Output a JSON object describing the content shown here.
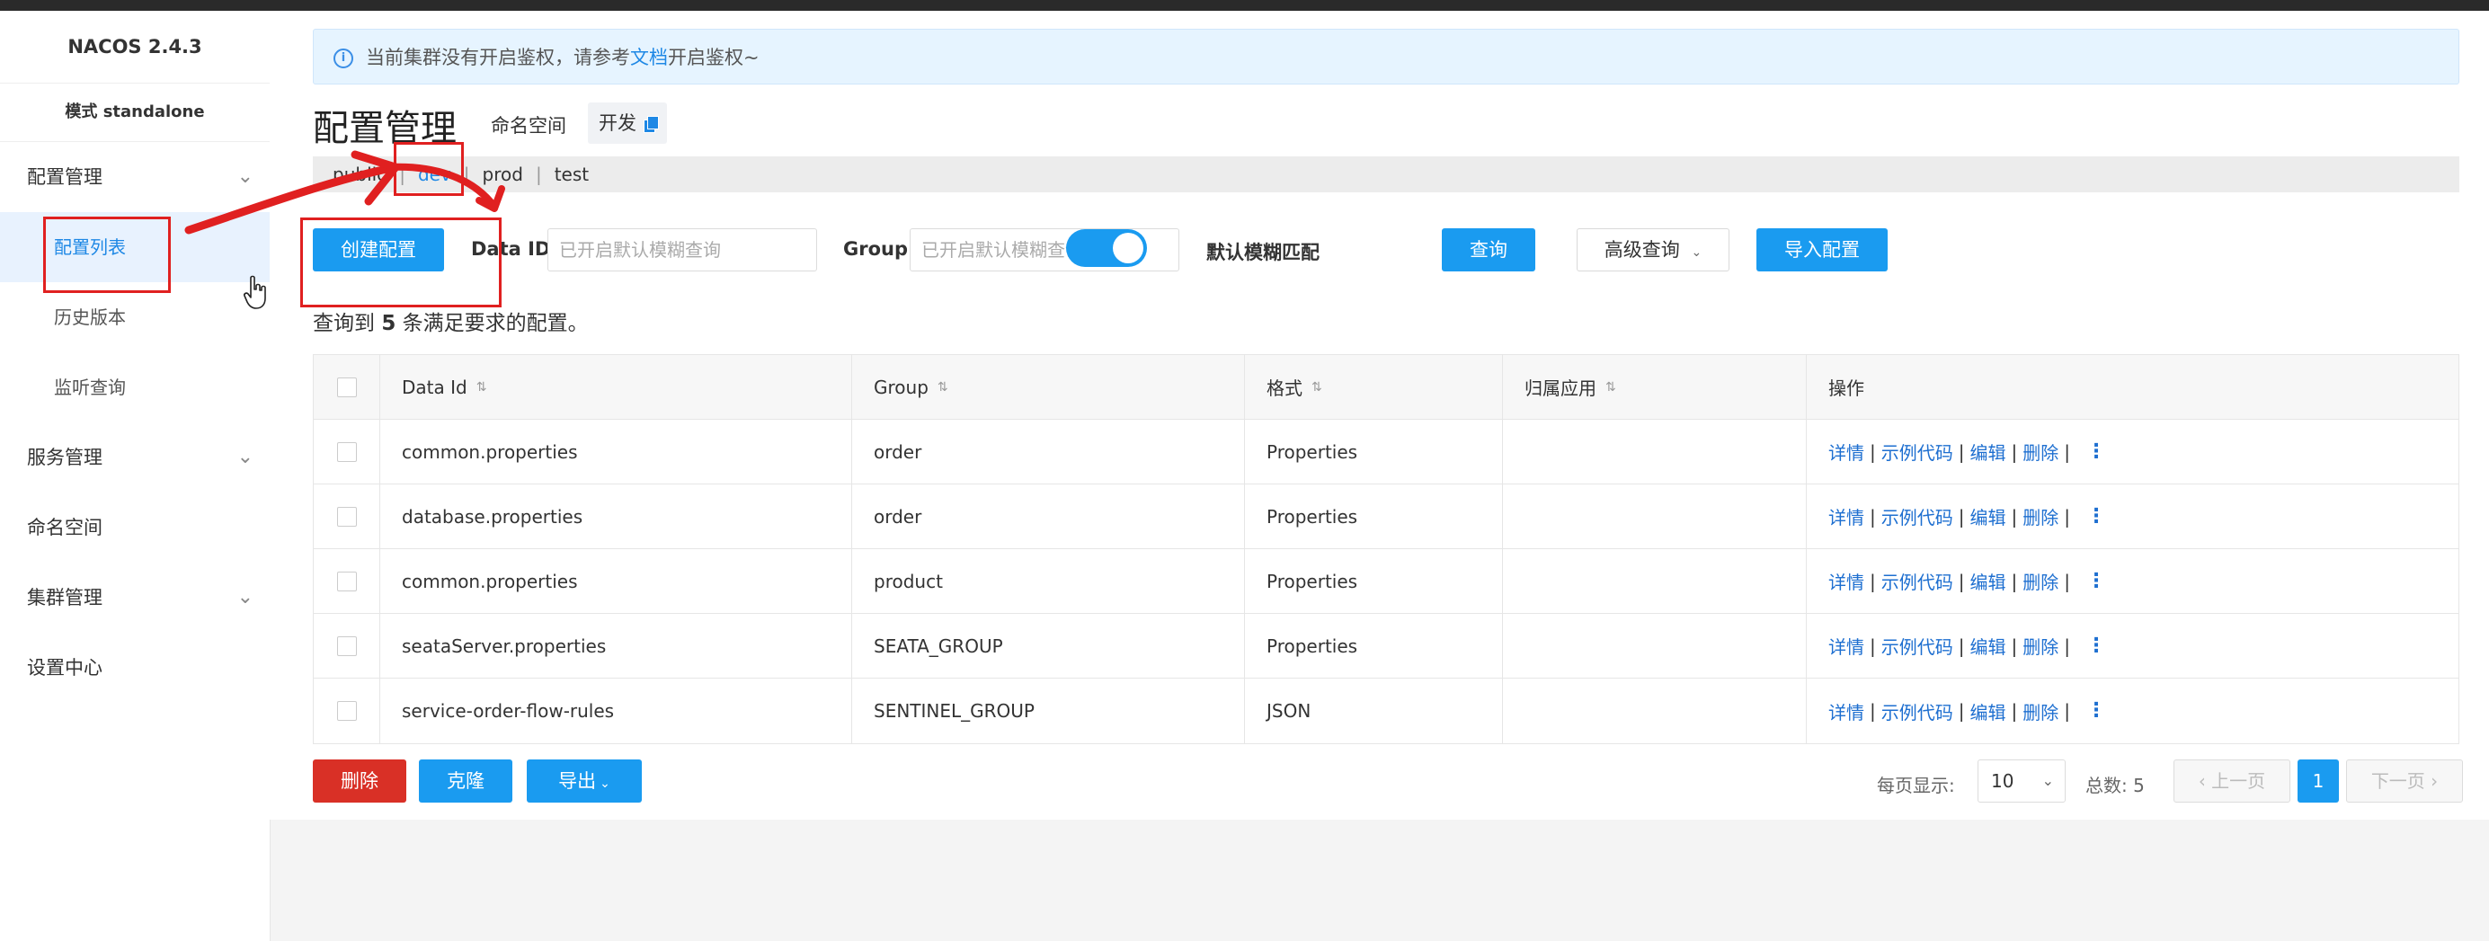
{
  "app": {
    "brand": "NACOS 2.4.3",
    "mode": "模式 standalone"
  },
  "sidebar": {
    "items": [
      {
        "label": "配置管理",
        "expandable": true
      },
      {
        "label": "配置列表",
        "active": true
      },
      {
        "label": "历史版本"
      },
      {
        "label": "监听查询"
      },
      {
        "label": "服务管理",
        "expandable": true
      },
      {
        "label": "命名空间"
      },
      {
        "label": "集群管理",
        "expandable": true
      },
      {
        "label": "设置中心"
      }
    ]
  },
  "notice": {
    "before": "当前集群没有开启鉴权，请参考",
    "link": "文档",
    "after": "开启鉴权~"
  },
  "header": {
    "title": "配置管理",
    "namespace_label": "命名空间",
    "namespace_current": "开发"
  },
  "namespace_tabs": [
    {
      "label": "public",
      "active": false
    },
    {
      "label": "dev",
      "active": true
    },
    {
      "label": "prod",
      "active": false
    },
    {
      "label": "test",
      "active": false
    }
  ],
  "toolbar": {
    "create_button": "创建配置",
    "data_id_label": "Data ID",
    "data_id_placeholder": "已开启默认模糊查询",
    "group_label": "Group",
    "group_placeholder": "已开启默认模糊查询",
    "fuzzy_label": "默认模糊匹配",
    "fuzzy_enabled": true,
    "query_button": "查询",
    "advanced_button": "高级查询",
    "import_button": "导入配置"
  },
  "result": {
    "prefix": "查询到",
    "count": "5",
    "suffix": "条满足要求的配置。"
  },
  "table": {
    "columns": [
      "Data Id",
      "Group",
      "格式",
      "归属应用",
      "操作"
    ],
    "rows": [
      {
        "data_id": "common.properties",
        "group": "order",
        "format": "Properties",
        "app": ""
      },
      {
        "data_id": "database.properties",
        "group": "order",
        "format": "Properties",
        "app": ""
      },
      {
        "data_id": "common.properties",
        "group": "product",
        "format": "Properties",
        "app": ""
      },
      {
        "data_id": "seataServer.properties",
        "group": "SEATA_GROUP",
        "format": "Properties",
        "app": ""
      },
      {
        "data_id": "service-order-flow-rules",
        "group": "SENTINEL_GROUP",
        "format": "JSON",
        "app": ""
      }
    ],
    "actions": [
      "详情",
      "示例代码",
      "编辑",
      "删除"
    ]
  },
  "bottom": {
    "delete_button": "删除",
    "clone_button": "克隆",
    "export_button": "导出"
  },
  "pagination": {
    "page_size_label": "每页显示:",
    "page_size": "10",
    "total_label": "总数: 5",
    "prev": "上一页",
    "current": "1",
    "next": "下一页"
  },
  "colors": {
    "primary": "#1a9bf0",
    "danger": "#d93026",
    "link": "#1e6fd0",
    "annotation": "#e02020"
  }
}
